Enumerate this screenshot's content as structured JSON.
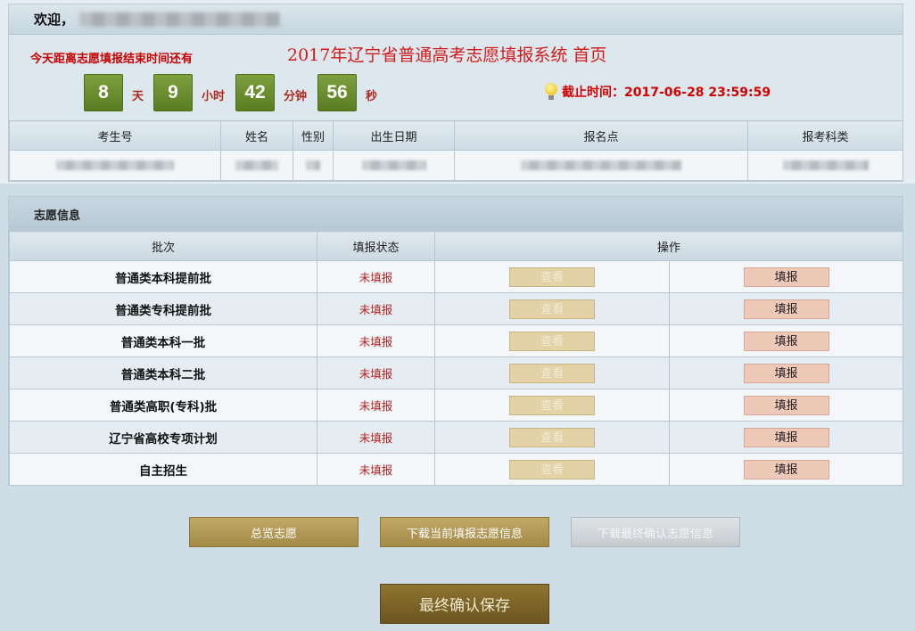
{
  "header": {
    "welcome_label": "欢迎，",
    "system_title": "2017年辽宁省普通高考志愿填报系统 首页",
    "countdown_label": "今天距离志愿填报结束时间还有",
    "countdown": [
      {
        "value": "8",
        "unit": "天"
      },
      {
        "value": "9",
        "unit": "小时"
      },
      {
        "value": "42",
        "unit": "分钟"
      },
      {
        "value": "56",
        "unit": "秒"
      }
    ],
    "deadline": "截止时间：2017-06-28 23:59:59",
    "icon": "lightbulb-icon"
  },
  "student_info": {
    "columns": [
      "考生号",
      "姓名",
      "性别",
      "出生日期",
      "报名点",
      "报考科类"
    ]
  },
  "volunteer": {
    "section_title": "志愿信息",
    "columns": {
      "batch": "批次",
      "status": "填报状态",
      "operation": "操作"
    },
    "view_label": "查看",
    "fill_label": "填报",
    "rows": [
      {
        "batch": "普通类本科提前批",
        "status": "未填报"
      },
      {
        "batch": "普通类专科提前批",
        "status": "未填报"
      },
      {
        "batch": "普通类本科一批",
        "status": "未填报"
      },
      {
        "batch": "普通类本科二批",
        "status": "未填报"
      },
      {
        "batch": "普通类高职(专科)批",
        "status": "未填报"
      },
      {
        "batch": "辽宁省高校专项计划",
        "status": "未填报"
      },
      {
        "batch": "自主招生",
        "status": "未填报"
      }
    ]
  },
  "actions": {
    "overview": "总览志愿",
    "download_current": "下载当前填报志愿信息",
    "download_final": "下载最终确认志愿信息",
    "final_confirm": "最终确认保存"
  },
  "colors": {
    "countdown_green": "#6a8c2c",
    "deadline_red": "#d40000",
    "title_red": "#d21a1a",
    "button_gold": "#a38a48",
    "confirm_brown": "#6d5620"
  }
}
